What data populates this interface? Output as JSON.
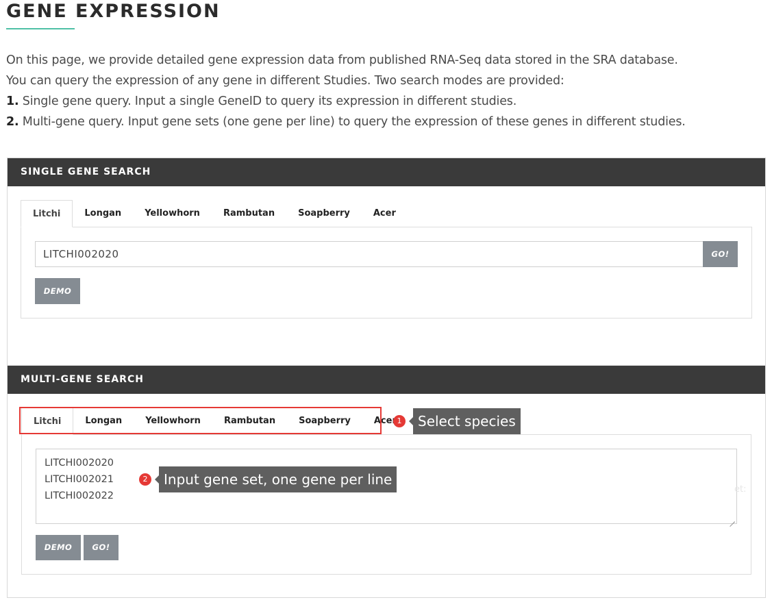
{
  "page": {
    "title": "GENE EXPRESSION",
    "intro_line1": "On this page, we provide detailed gene expression data from published RNA-Seq data stored in the SRA database.",
    "intro_line2": "You can query the expression of any gene in different Studies. Two search modes are provided:",
    "mode1_num": "1.",
    "mode1_text": " Single gene query. Input a single GeneID to query its expression in different studies.",
    "mode2_num": "2.",
    "mode2_text": " Multi-gene query. Input gene sets (one gene per line) to query the expression of these genes in different studies."
  },
  "single_search": {
    "header": "SINGLE GENE SEARCH",
    "tabs": [
      "Litchi",
      "Longan",
      "Yellowhorn",
      "Rambutan",
      "Soapberry",
      "Acer"
    ],
    "active_tab": "Litchi",
    "input_value": "LITCHI002020",
    "go_label": "GO!",
    "demo_label": "DEMO"
  },
  "multi_search": {
    "header": "MULTI-GENE SEARCH",
    "tabs": [
      "Litchi",
      "Longan",
      "Yellowhorn",
      "Rambutan",
      "Soapberry",
      "Acer"
    ],
    "active_tab": "Litchi",
    "textarea_lines": [
      "LITCHI002020",
      "LITCHI002021",
      "LITCHI002022"
    ],
    "demo_label": "DEMO",
    "go_label": "GO!",
    "faint_text": "et:"
  },
  "callouts": [
    {
      "number": "1",
      "text": "Select species"
    },
    {
      "number": "2",
      "text": "Input gene set, one gene per line"
    }
  ],
  "colors": {
    "header_bg": "#3a3a3a",
    "accent_underline": "#4ec0a6",
    "button_bg": "#858c93",
    "highlight_red": "#e53935",
    "callout_bg": "#5f5f5f"
  }
}
